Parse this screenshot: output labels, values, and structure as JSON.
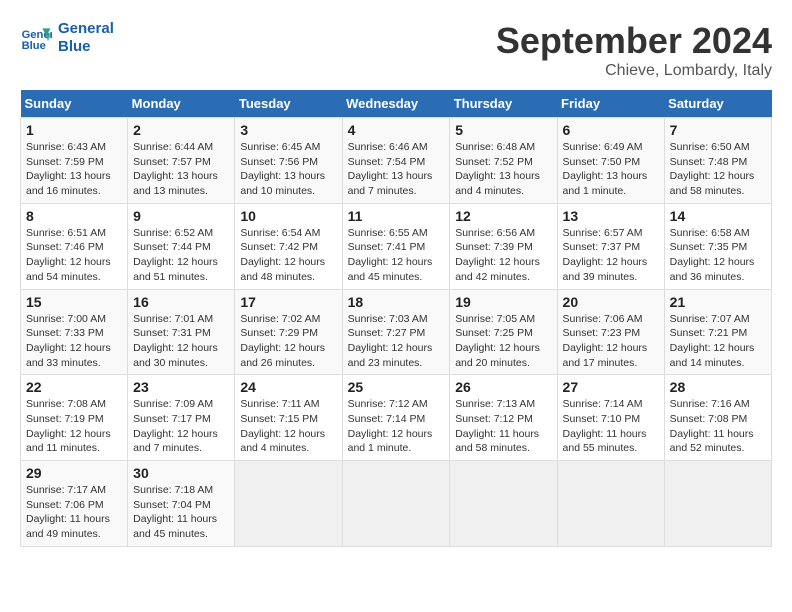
{
  "header": {
    "logo_line1": "General",
    "logo_line2": "Blue",
    "month": "September 2024",
    "location": "Chieve, Lombardy, Italy"
  },
  "weekdays": [
    "Sunday",
    "Monday",
    "Tuesday",
    "Wednesday",
    "Thursday",
    "Friday",
    "Saturday"
  ],
  "weeks": [
    [
      {
        "day": "1",
        "info": "Sunrise: 6:43 AM\nSunset: 7:59 PM\nDaylight: 13 hours\nand 16 minutes."
      },
      {
        "day": "2",
        "info": "Sunrise: 6:44 AM\nSunset: 7:57 PM\nDaylight: 13 hours\nand 13 minutes."
      },
      {
        "day": "3",
        "info": "Sunrise: 6:45 AM\nSunset: 7:56 PM\nDaylight: 13 hours\nand 10 minutes."
      },
      {
        "day": "4",
        "info": "Sunrise: 6:46 AM\nSunset: 7:54 PM\nDaylight: 13 hours\nand 7 minutes."
      },
      {
        "day": "5",
        "info": "Sunrise: 6:48 AM\nSunset: 7:52 PM\nDaylight: 13 hours\nand 4 minutes."
      },
      {
        "day": "6",
        "info": "Sunrise: 6:49 AM\nSunset: 7:50 PM\nDaylight: 13 hours\nand 1 minute."
      },
      {
        "day": "7",
        "info": "Sunrise: 6:50 AM\nSunset: 7:48 PM\nDaylight: 12 hours\nand 58 minutes."
      }
    ],
    [
      {
        "day": "8",
        "info": "Sunrise: 6:51 AM\nSunset: 7:46 PM\nDaylight: 12 hours\nand 54 minutes."
      },
      {
        "day": "9",
        "info": "Sunrise: 6:52 AM\nSunset: 7:44 PM\nDaylight: 12 hours\nand 51 minutes."
      },
      {
        "day": "10",
        "info": "Sunrise: 6:54 AM\nSunset: 7:42 PM\nDaylight: 12 hours\nand 48 minutes."
      },
      {
        "day": "11",
        "info": "Sunrise: 6:55 AM\nSunset: 7:41 PM\nDaylight: 12 hours\nand 45 minutes."
      },
      {
        "day": "12",
        "info": "Sunrise: 6:56 AM\nSunset: 7:39 PM\nDaylight: 12 hours\nand 42 minutes."
      },
      {
        "day": "13",
        "info": "Sunrise: 6:57 AM\nSunset: 7:37 PM\nDaylight: 12 hours\nand 39 minutes."
      },
      {
        "day": "14",
        "info": "Sunrise: 6:58 AM\nSunset: 7:35 PM\nDaylight: 12 hours\nand 36 minutes."
      }
    ],
    [
      {
        "day": "15",
        "info": "Sunrise: 7:00 AM\nSunset: 7:33 PM\nDaylight: 12 hours\nand 33 minutes."
      },
      {
        "day": "16",
        "info": "Sunrise: 7:01 AM\nSunset: 7:31 PM\nDaylight: 12 hours\nand 30 minutes."
      },
      {
        "day": "17",
        "info": "Sunrise: 7:02 AM\nSunset: 7:29 PM\nDaylight: 12 hours\nand 26 minutes."
      },
      {
        "day": "18",
        "info": "Sunrise: 7:03 AM\nSunset: 7:27 PM\nDaylight: 12 hours\nand 23 minutes."
      },
      {
        "day": "19",
        "info": "Sunrise: 7:05 AM\nSunset: 7:25 PM\nDaylight: 12 hours\nand 20 minutes."
      },
      {
        "day": "20",
        "info": "Sunrise: 7:06 AM\nSunset: 7:23 PM\nDaylight: 12 hours\nand 17 minutes."
      },
      {
        "day": "21",
        "info": "Sunrise: 7:07 AM\nSunset: 7:21 PM\nDaylight: 12 hours\nand 14 minutes."
      }
    ],
    [
      {
        "day": "22",
        "info": "Sunrise: 7:08 AM\nSunset: 7:19 PM\nDaylight: 12 hours\nand 11 minutes."
      },
      {
        "day": "23",
        "info": "Sunrise: 7:09 AM\nSunset: 7:17 PM\nDaylight: 12 hours\nand 7 minutes."
      },
      {
        "day": "24",
        "info": "Sunrise: 7:11 AM\nSunset: 7:15 PM\nDaylight: 12 hours\nand 4 minutes."
      },
      {
        "day": "25",
        "info": "Sunrise: 7:12 AM\nSunset: 7:14 PM\nDaylight: 12 hours\nand 1 minute."
      },
      {
        "day": "26",
        "info": "Sunrise: 7:13 AM\nSunset: 7:12 PM\nDaylight: 11 hours\nand 58 minutes."
      },
      {
        "day": "27",
        "info": "Sunrise: 7:14 AM\nSunset: 7:10 PM\nDaylight: 11 hours\nand 55 minutes."
      },
      {
        "day": "28",
        "info": "Sunrise: 7:16 AM\nSunset: 7:08 PM\nDaylight: 11 hours\nand 52 minutes."
      }
    ],
    [
      {
        "day": "29",
        "info": "Sunrise: 7:17 AM\nSunset: 7:06 PM\nDaylight: 11 hours\nand 49 minutes."
      },
      {
        "day": "30",
        "info": "Sunrise: 7:18 AM\nSunset: 7:04 PM\nDaylight: 11 hours\nand 45 minutes."
      },
      {
        "day": "",
        "info": ""
      },
      {
        "day": "",
        "info": ""
      },
      {
        "day": "",
        "info": ""
      },
      {
        "day": "",
        "info": ""
      },
      {
        "day": "",
        "info": ""
      }
    ]
  ]
}
